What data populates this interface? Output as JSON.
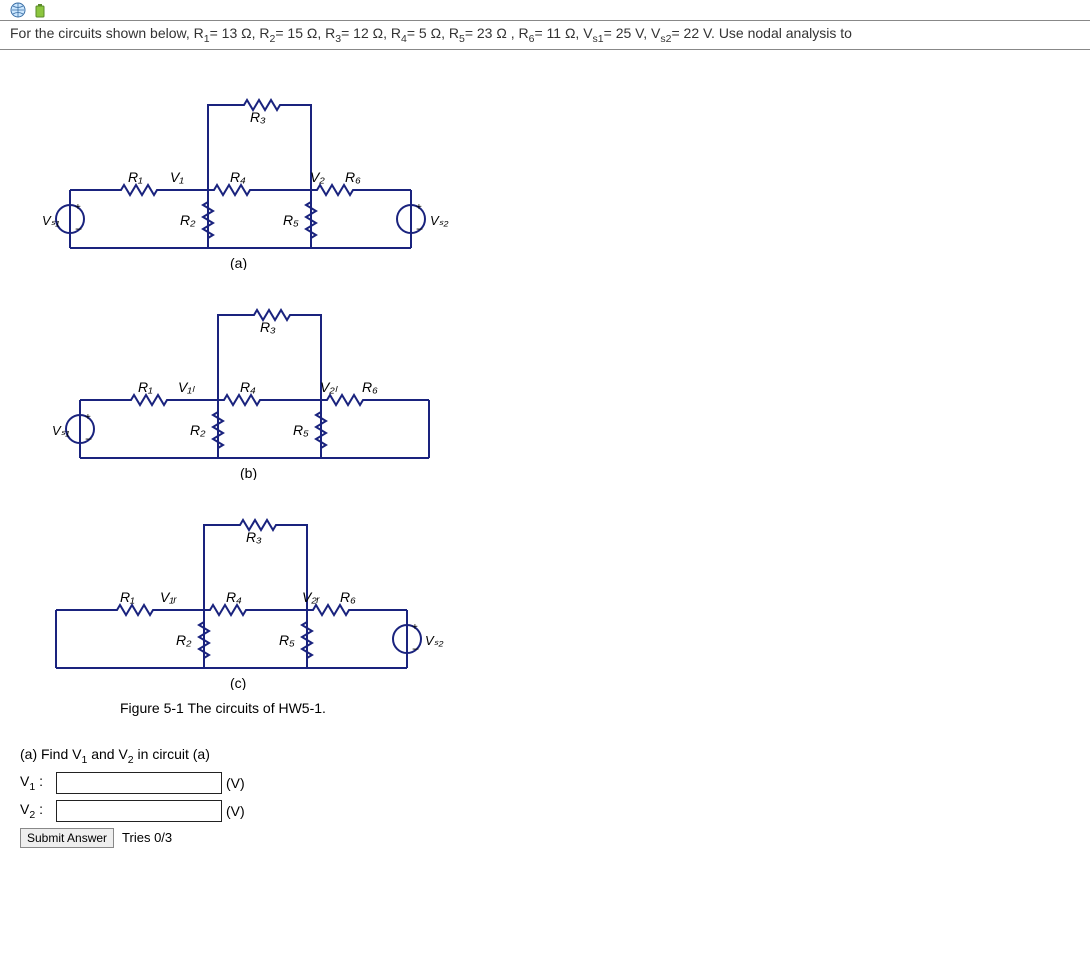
{
  "problem_intro": "For the circuits shown below, R",
  "values": {
    "R1": "13 Ω",
    "R2": "15 Ω",
    "R3": "12 Ω",
    "R4": "5 Ω",
    "R5": "23 Ω",
    "R6": "11 Ω",
    "Vs1": "25 V",
    "Vs2": "22 V"
  },
  "problem_tail": ". Use nodal analysis to",
  "circuit": {
    "a": {
      "labels": {
        "R1": "R₁",
        "R2": "R₂",
        "R3": "R₃",
        "R4": "R₄",
        "R5": "R₅",
        "R6": "R₆",
        "Vs1": "Vₛ₁",
        "Vs2": "Vₛ₂",
        "V1": "V₁",
        "V2": "V₂"
      },
      "caption": "(a)"
    },
    "b": {
      "labels": {
        "R1": "R₁",
        "R2": "R₂",
        "R3": "R₃",
        "R4": "R₄",
        "R5": "R₅",
        "R6": "R₆",
        "Vs1": "Vₛ₁",
        "V1L": "V₁ₗ",
        "V2L": "V₂ₗ"
      },
      "caption": "(b)"
    },
    "c": {
      "labels": {
        "R1": "R₁",
        "R2": "R₂",
        "R3": "R₃",
        "R4": "R₄",
        "R5": "R₅",
        "R6": "R₆",
        "Vs2": "Vₛ₂",
        "V1R": "V₁ᵣ",
        "V2R": "V₂ᵣ"
      },
      "caption": "(c)"
    }
  },
  "figure_title": "Figure 5-1 The circuits of HW5-1.",
  "part_a": {
    "prompt_prefix": "(a) Find V",
    "prompt_mid": " and V",
    "prompt_suffix": " in circuit (a)",
    "row1_label_prefix": "V",
    "row1_label_sub": "1",
    "row1_unit": "(V)",
    "row2_label_prefix": "V",
    "row2_label_sub": "2",
    "row2_unit": "(V)"
  },
  "submit_label": "Submit Answer",
  "tries": "Tries 0/3"
}
